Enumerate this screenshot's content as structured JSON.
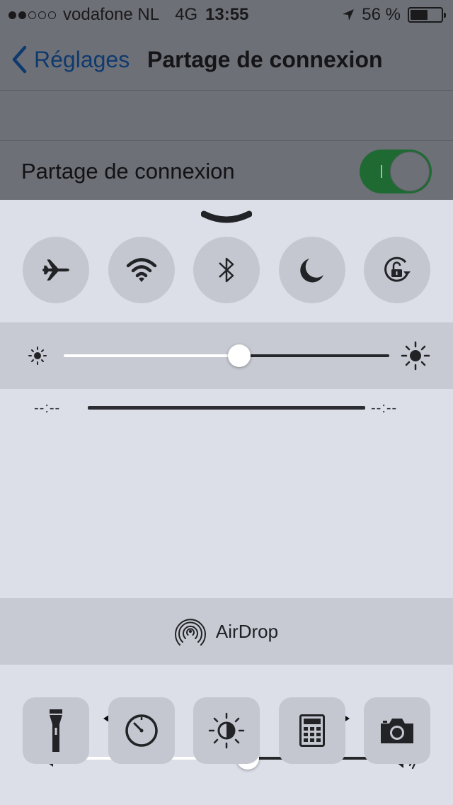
{
  "status_bar": {
    "carrier": "vodafone NL",
    "network": "4G",
    "time": "13:55",
    "battery_percent": "56 %",
    "battery_level": 0.56,
    "signal_bars_filled": 2,
    "signal_bars_total": 5
  },
  "nav": {
    "back_label": "Réglages",
    "title": "Partage de connexion"
  },
  "settings": {
    "hotspot_label": "Partage de connexion",
    "hotspot_on": true
  },
  "control_center": {
    "toggles": [
      {
        "icon": "airplane-icon"
      },
      {
        "icon": "wifi-icon"
      },
      {
        "icon": "bluetooth-icon"
      },
      {
        "icon": "moon-icon"
      },
      {
        "icon": "rotation-lock-icon"
      }
    ],
    "brightness_level": 0.54,
    "media": {
      "elapsed": "--:--",
      "remaining": "--:--"
    },
    "volume_level": 0.57,
    "airdrop_label": "AirDrop",
    "shortcuts": [
      {
        "icon": "flashlight-icon"
      },
      {
        "icon": "timer-icon"
      },
      {
        "icon": "night-shift-icon"
      },
      {
        "icon": "calculator-icon"
      },
      {
        "icon": "camera-icon"
      }
    ]
  },
  "colors": {
    "accent_blue": "#0f3a6e",
    "toggle_green": "#1f6a33",
    "control_center_bg": "#dcdee8"
  }
}
